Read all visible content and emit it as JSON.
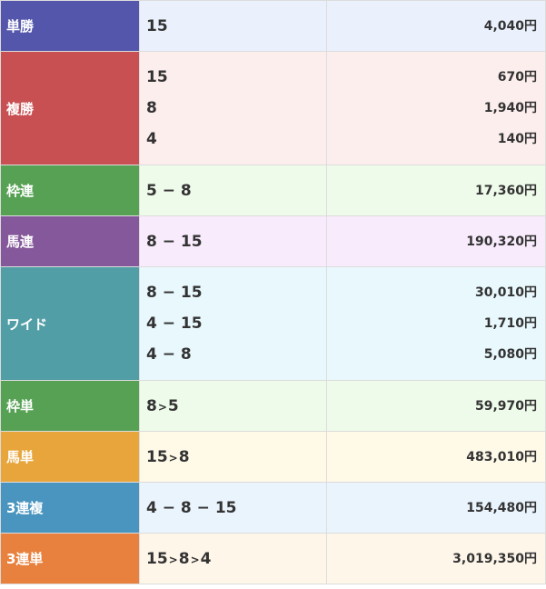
{
  "rows": [
    {
      "key": "tansho",
      "label": "単勝",
      "color": "#5356ab",
      "bg": "#eaf1fd",
      "entries": [
        {
          "combo": "15",
          "payout": "4,040円"
        }
      ]
    },
    {
      "key": "fukusho",
      "label": "複勝",
      "color": "#c84f52",
      "bg": "#fdeeee",
      "entries": [
        {
          "combo": "15",
          "payout": "670円"
        },
        {
          "combo": "8",
          "payout": "1,940円"
        },
        {
          "combo": "4",
          "payout": "140円"
        }
      ]
    },
    {
      "key": "wakuren",
      "label": "枠連",
      "color": "#56a153",
      "bg": "#effbea",
      "entries": [
        {
          "combo": "5 − 8",
          "payout": "17,360円"
        }
      ]
    },
    {
      "key": "umaren",
      "label": "馬連",
      "color": "#84589a",
      "bg": "#f8ebfc",
      "entries": [
        {
          "combo": "8 − 15",
          "payout": "190,320円"
        }
      ]
    },
    {
      "key": "wide",
      "label": "ワイド",
      "color": "#529ea6",
      "bg": "#e8f8fd",
      "entries": [
        {
          "combo": "8 − 15",
          "payout": "30,010円"
        },
        {
          "combo": "4 − 15",
          "payout": "1,710円"
        },
        {
          "combo": "4 − 8",
          "payout": "5,080円"
        }
      ]
    },
    {
      "key": "wakutan",
      "label": "枠単",
      "color": "#56a153",
      "bg": "#effbea",
      "entries": [
        {
          "combo": "8 > 5",
          "payout": "59,970円"
        }
      ]
    },
    {
      "key": "umatan",
      "label": "馬単",
      "color": "#e7a53c",
      "bg": "#fff9e8",
      "entries": [
        {
          "combo": "15 > 8",
          "payout": "483,010円"
        }
      ]
    },
    {
      "key": "sanrenpuku",
      "label": "3連複",
      "color": "#4a95c0",
      "bg": "#eaf4fd",
      "entries": [
        {
          "combo": "4 − 8 − 15",
          "payout": "154,480円"
        }
      ]
    },
    {
      "key": "sanrentan",
      "label": "3連単",
      "color": "#e8813e",
      "bg": "#fff6ea",
      "entries": [
        {
          "combo": "15 > 8 > 4",
          "payout": "3,019,350円"
        }
      ]
    }
  ]
}
